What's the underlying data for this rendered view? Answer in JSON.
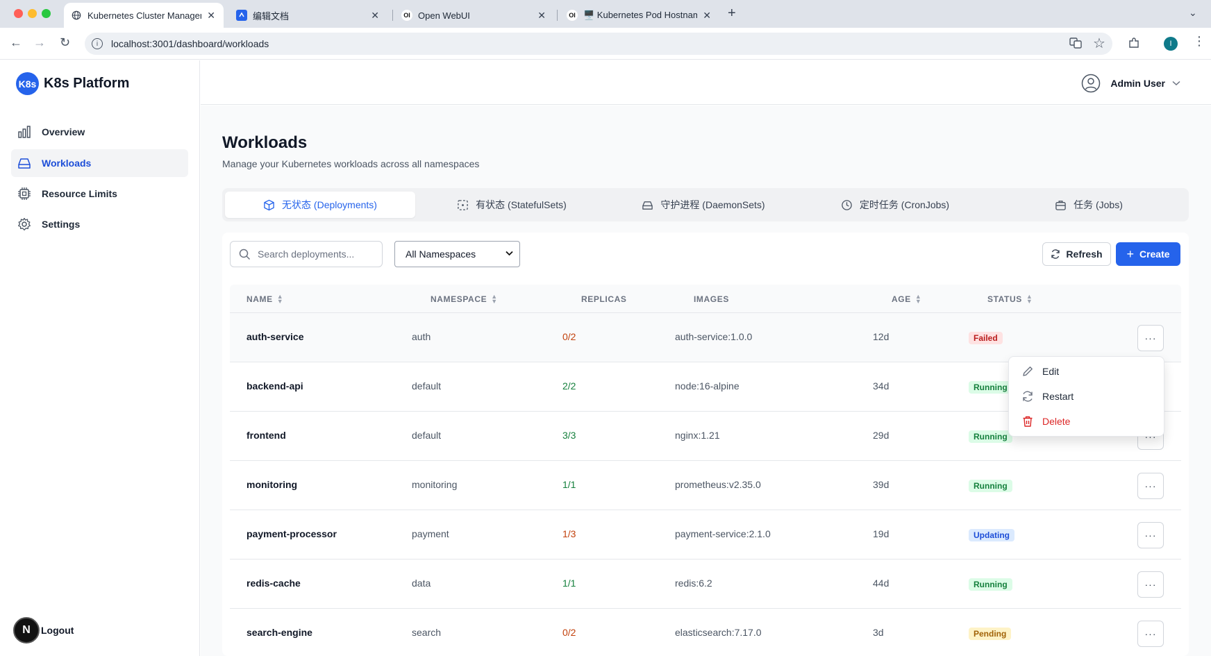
{
  "browser": {
    "tabs": [
      {
        "title": "Kubernetes Cluster Managem",
        "favicon": "globe-icon"
      },
      {
        "title": "编辑文档",
        "favicon": "doc-icon"
      },
      {
        "title": "Open WebUI",
        "favicon": "OI"
      },
      {
        "title": "🖥️ Kubernetes Pod Hostname",
        "favicon": "OI"
      }
    ],
    "url": "localhost:3001/dashboard/workloads"
  },
  "sidebar": {
    "brand_logo": "K8s",
    "brand_name": "K8s Platform",
    "items": [
      {
        "label": "Overview",
        "icon": "bar-chart-icon"
      },
      {
        "label": "Workloads",
        "icon": "drive-icon"
      },
      {
        "label": "Resource Limits",
        "icon": "cpu-icon"
      },
      {
        "label": "Settings",
        "icon": "gear-icon"
      }
    ],
    "logout_avatar": "N",
    "logout_label": "Logout"
  },
  "header": {
    "user_name": "Admin User"
  },
  "page": {
    "title": "Workloads",
    "subtitle": "Manage your Kubernetes workloads across all namespaces"
  },
  "workload_tabs": [
    {
      "label": "无状态 (Deployments)",
      "active": true
    },
    {
      "label": "有状态 (StatefulSets)",
      "active": false
    },
    {
      "label": "守护进程 (DaemonSets)",
      "active": false
    },
    {
      "label": "定时任务 (CronJobs)",
      "active": false
    },
    {
      "label": "任务 (Jobs)",
      "active": false
    }
  ],
  "toolbar": {
    "search_placeholder": "Search deployments...",
    "namespace_selected": "All Namespaces",
    "refresh_label": "Refresh",
    "create_label": "Create"
  },
  "table": {
    "columns": [
      "NAME",
      "NAMESPACE",
      "REPLICAS",
      "IMAGES",
      "AGE",
      "STATUS"
    ],
    "rows": [
      {
        "name": "auth-service",
        "namespace": "auth",
        "replicas": "0/2",
        "image": "auth-service:1.0.0",
        "age": "12d",
        "status": "Failed"
      },
      {
        "name": "backend-api",
        "namespace": "default",
        "replicas": "2/2",
        "image": "node:16-alpine",
        "age": "34d",
        "status": "Running"
      },
      {
        "name": "frontend",
        "namespace": "default",
        "replicas": "3/3",
        "image": "nginx:1.21",
        "age": "29d",
        "status": "Running"
      },
      {
        "name": "monitoring",
        "namespace": "monitoring",
        "replicas": "1/1",
        "image": "prometheus:v2.35.0",
        "age": "39d",
        "status": "Running"
      },
      {
        "name": "payment-processor",
        "namespace": "payment",
        "replicas": "1/3",
        "image": "payment-service:2.1.0",
        "age": "19d",
        "status": "Updating"
      },
      {
        "name": "redis-cache",
        "namespace": "data",
        "replicas": "1/1",
        "image": "redis:6.2",
        "age": "44d",
        "status": "Running"
      },
      {
        "name": "search-engine",
        "namespace": "search",
        "replicas": "0/2",
        "image": "elasticsearch:7.17.0",
        "age": "3d",
        "status": "Pending"
      }
    ],
    "more_label": "···"
  },
  "row_menu": {
    "edit": "Edit",
    "restart": "Restart",
    "delete": "Delete"
  },
  "colors": {
    "accent": "#2563eb",
    "danger": "#dc2626",
    "success": "#15803d",
    "warning": "#c2410c"
  }
}
